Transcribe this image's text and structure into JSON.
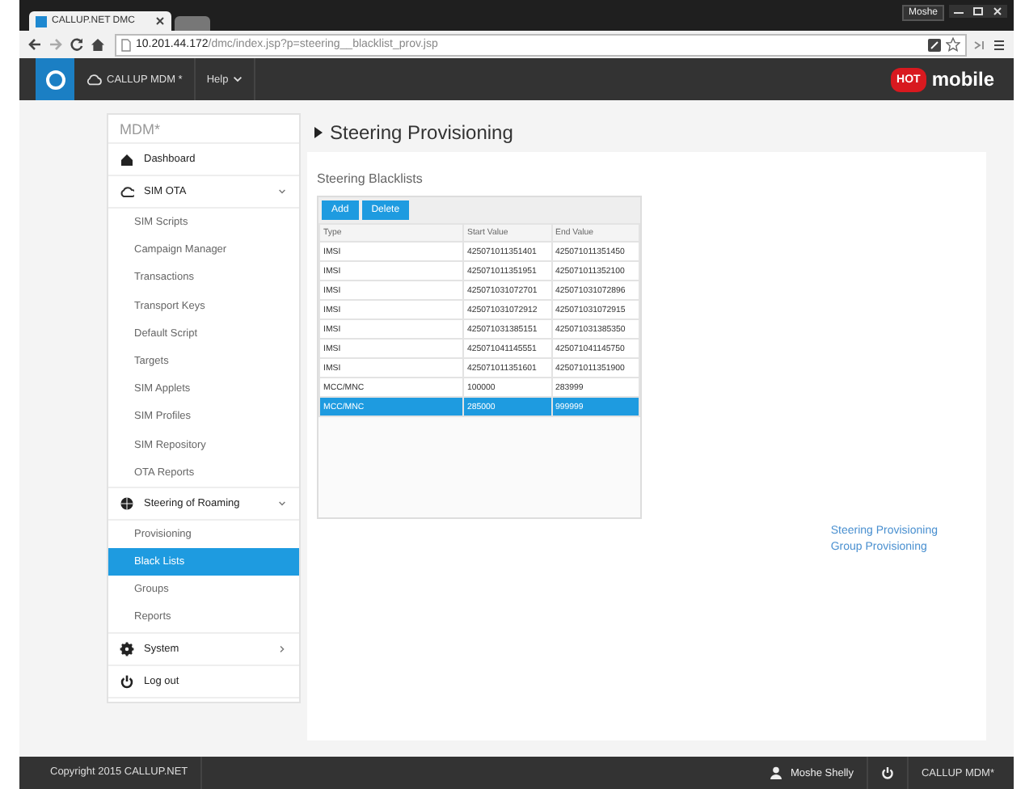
{
  "browser": {
    "tabs": [
      {
        "label": "CALLUP.NET DMC",
        "selected": true
      },
      {
        "selected": false
      }
    ],
    "profile": "Moshe",
    "url": {
      "host": "10.201.44.172",
      "path": "/dmc/index.jsp?p=steering__blacklist_prov.jsp"
    }
  },
  "app_bar": {
    "brand": "CALLUP MDM *",
    "menu": "Help",
    "logo_badge": "HOT",
    "logo_word": "mobile"
  },
  "sidebar": {
    "title": "MDM*",
    "items": [
      {
        "kind": "link",
        "label": "Dashboard",
        "selected": false
      },
      {
        "kind": "group",
        "label": "SIM OTA",
        "expanded": true,
        "children": [
          {
            "label": "SIM Scripts",
            "selected": false
          },
          {
            "label": "Campaign Manager",
            "selected": false
          },
          {
            "label": "Transactions",
            "selected": false
          },
          {
            "label": "Transport Keys",
            "selected": false
          },
          {
            "label": "Default Script",
            "selected": false
          },
          {
            "label": "Targets",
            "selected": false
          },
          {
            "label": "SIM Applets",
            "selected": false
          },
          {
            "label": "SIM Profiles",
            "selected": false
          },
          {
            "label": "SIM Repository",
            "selected": false
          },
          {
            "label": "OTA Reports",
            "selected": false
          }
        ]
      },
      {
        "kind": "group",
        "label": "Steering of Roaming",
        "expanded": true,
        "children": [
          {
            "label": "Provisioning",
            "selected": false
          },
          {
            "label": "Black Lists",
            "selected": true
          },
          {
            "label": "Groups",
            "selected": false
          },
          {
            "label": "Reports",
            "selected": false
          }
        ]
      },
      {
        "kind": "group",
        "label": "System",
        "expanded": false
      },
      {
        "kind": "link",
        "label": "Log out",
        "selected": false
      }
    ]
  },
  "page": {
    "title": "Steering Provisioning",
    "panel_title": "Steering Blacklists",
    "buttons": [
      "Add",
      "Delete"
    ],
    "table": {
      "columns": [
        "Type",
        "Start Value",
        "End Value"
      ],
      "rows": [
        {
          "cells": [
            "IMSI",
            "425071011351401",
            "425071011351450"
          ],
          "selected": false
        },
        {
          "cells": [
            "IMSI",
            "425071011351951",
            "425071011352100"
          ],
          "selected": false
        },
        {
          "cells": [
            "IMSI",
            "425071031072701",
            "425071031072896"
          ],
          "selected": false
        },
        {
          "cells": [
            "IMSI",
            "425071031072912",
            "425071031072915"
          ],
          "selected": false
        },
        {
          "cells": [
            "IMSI",
            "425071031385151",
            "425071031385350"
          ],
          "selected": false
        },
        {
          "cells": [
            "IMSI",
            "425071041145551",
            "425071041145750"
          ],
          "selected": false
        },
        {
          "cells": [
            "IMSI",
            "425071011351601",
            "425071011351900"
          ],
          "selected": false
        },
        {
          "cells": [
            "MCC/MNC",
            "100000",
            "283999"
          ],
          "selected": false
        },
        {
          "cells": [
            "MCC/MNC",
            "285000",
            "999999"
          ],
          "selected": true
        }
      ]
    },
    "links": [
      "Steering Provisioning",
      "Group Provisioning"
    ]
  },
  "footer": {
    "copyright": "Copyright 2015  CALLUP.NET",
    "user": "Moshe Shelly",
    "product": "CALLUP MDM*"
  }
}
